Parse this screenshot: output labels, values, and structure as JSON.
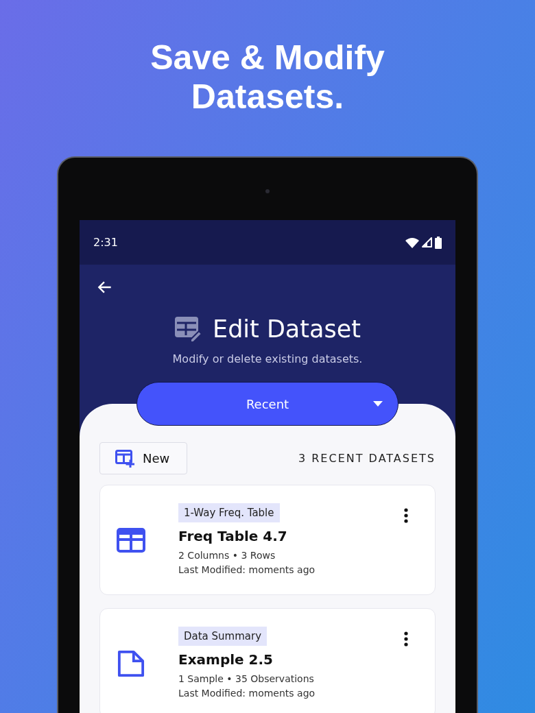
{
  "headline": "Save & Modify Datasets.",
  "status_bar": {
    "time": "2:31"
  },
  "header": {
    "title": "Edit Dataset",
    "subtitle": "Modify or delete existing datasets."
  },
  "dropdown": {
    "value": "Recent"
  },
  "new_button": {
    "label": "New"
  },
  "count_label": "3 RECENT DATASETS",
  "datasets": [
    {
      "kind": "table",
      "tag": "1-Way Freq. Table",
      "name": "Freq Table 4.7",
      "details": "2 Columns • 3 Rows",
      "modified": "Last Modified: moments ago"
    },
    {
      "kind": "file",
      "tag": "Data Summary",
      "name": "Example 2.5",
      "details": "1 Sample • 35 Observations",
      "modified": "Last Modified: moments ago"
    }
  ]
}
